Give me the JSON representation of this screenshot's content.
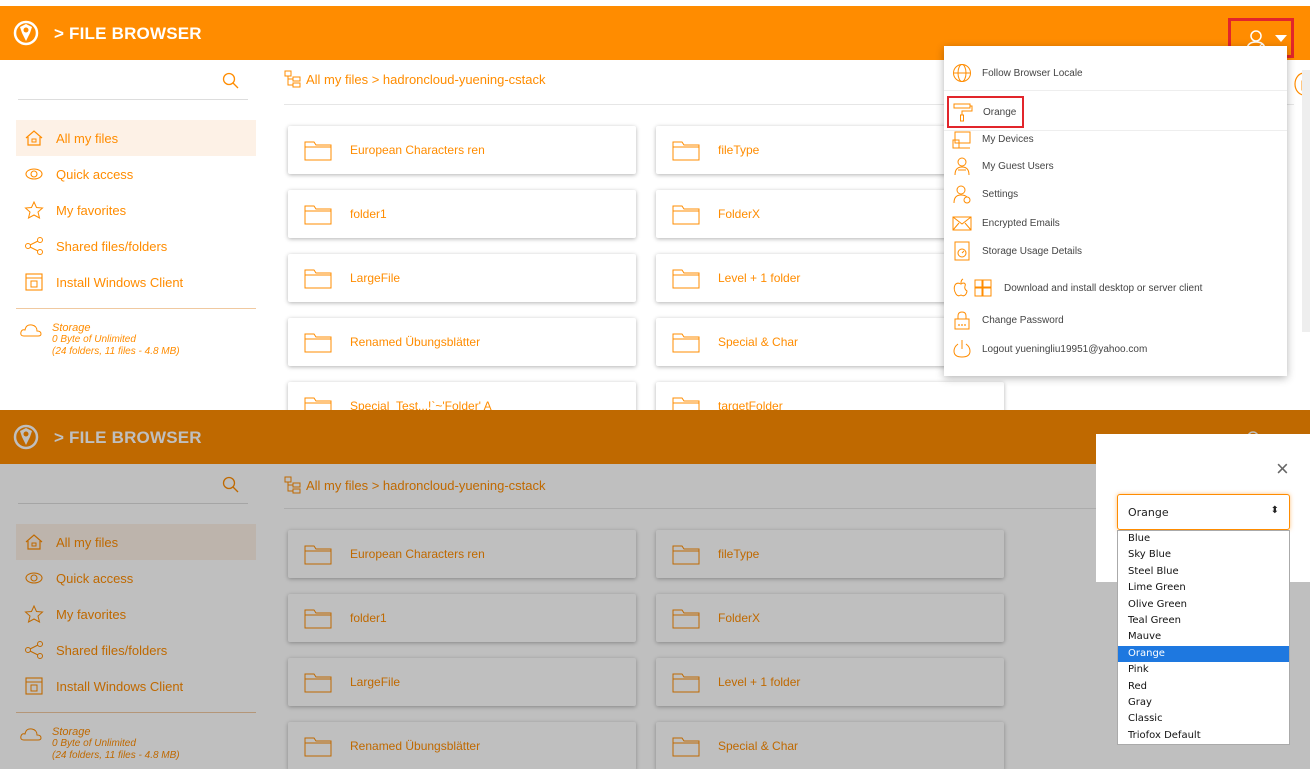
{
  "app": {
    "title": "> FILE BROWSER"
  },
  "search": {
    "placeholder": ""
  },
  "sidebar": {
    "items": [
      {
        "label": "All my files",
        "icon": "home-icon"
      },
      {
        "label": "Quick access",
        "icon": "eye-icon"
      },
      {
        "label": "My favorites",
        "icon": "star-icon"
      },
      {
        "label": "Shared files/folders",
        "icon": "share-icon"
      },
      {
        "label": "Install Windows Client",
        "icon": "installer-icon"
      }
    ],
    "storage": {
      "title": "Storage",
      "quota": "0 Byte of Unlimited",
      "summary": "(24 folders, 11 files - 4.8 MB)"
    }
  },
  "breadcrumb": {
    "text": "All my files > hadroncloud-yuening-cstack"
  },
  "folders": [
    "European Characters ren",
    "fileType",
    "folder1",
    "FolderX",
    "LargeFile",
    "Level + 1 folder",
    "Renamed Übungsblätter",
    "Special & Char",
    "Special_Test...!`~'Folder' A",
    "targetFolder"
  ],
  "user_menu": {
    "items": [
      {
        "label": "Follow Browser Locale",
        "icon": "globe-icon"
      },
      {
        "label": "Orange",
        "icon": "paint-roller-icon"
      },
      {
        "label": "My Devices",
        "icon": "devices-icon"
      },
      {
        "label": "My Guest Users",
        "icon": "guest-user-icon"
      },
      {
        "label": "Settings",
        "icon": "user-settings-icon"
      },
      {
        "label": "Encrypted Emails",
        "icon": "encrypted-email-icon"
      },
      {
        "label": "Storage Usage Details",
        "icon": "storage-usage-icon"
      },
      {
        "label": "Download and install desktop or server client",
        "icon": "apple-windows-icon"
      },
      {
        "label": "Change Password",
        "icon": "lock-icon"
      },
      {
        "label": "Logout yueningliu19951@yahoo.com",
        "icon": "power-icon"
      }
    ]
  },
  "theme_dialog": {
    "close_label": "×",
    "selected": "Orange",
    "options": [
      "Blue",
      "Sky Blue",
      "Steel Blue",
      "Lime Green",
      "Olive Green",
      "Teal Green",
      "Mauve",
      "Orange",
      "Pink",
      "Red",
      "Gray",
      "Classic",
      "Triofox Default"
    ]
  },
  "colors": {
    "accent": "#ff8c00",
    "highlight_box": "#e2252b",
    "option_selected": "#1e78e0"
  }
}
